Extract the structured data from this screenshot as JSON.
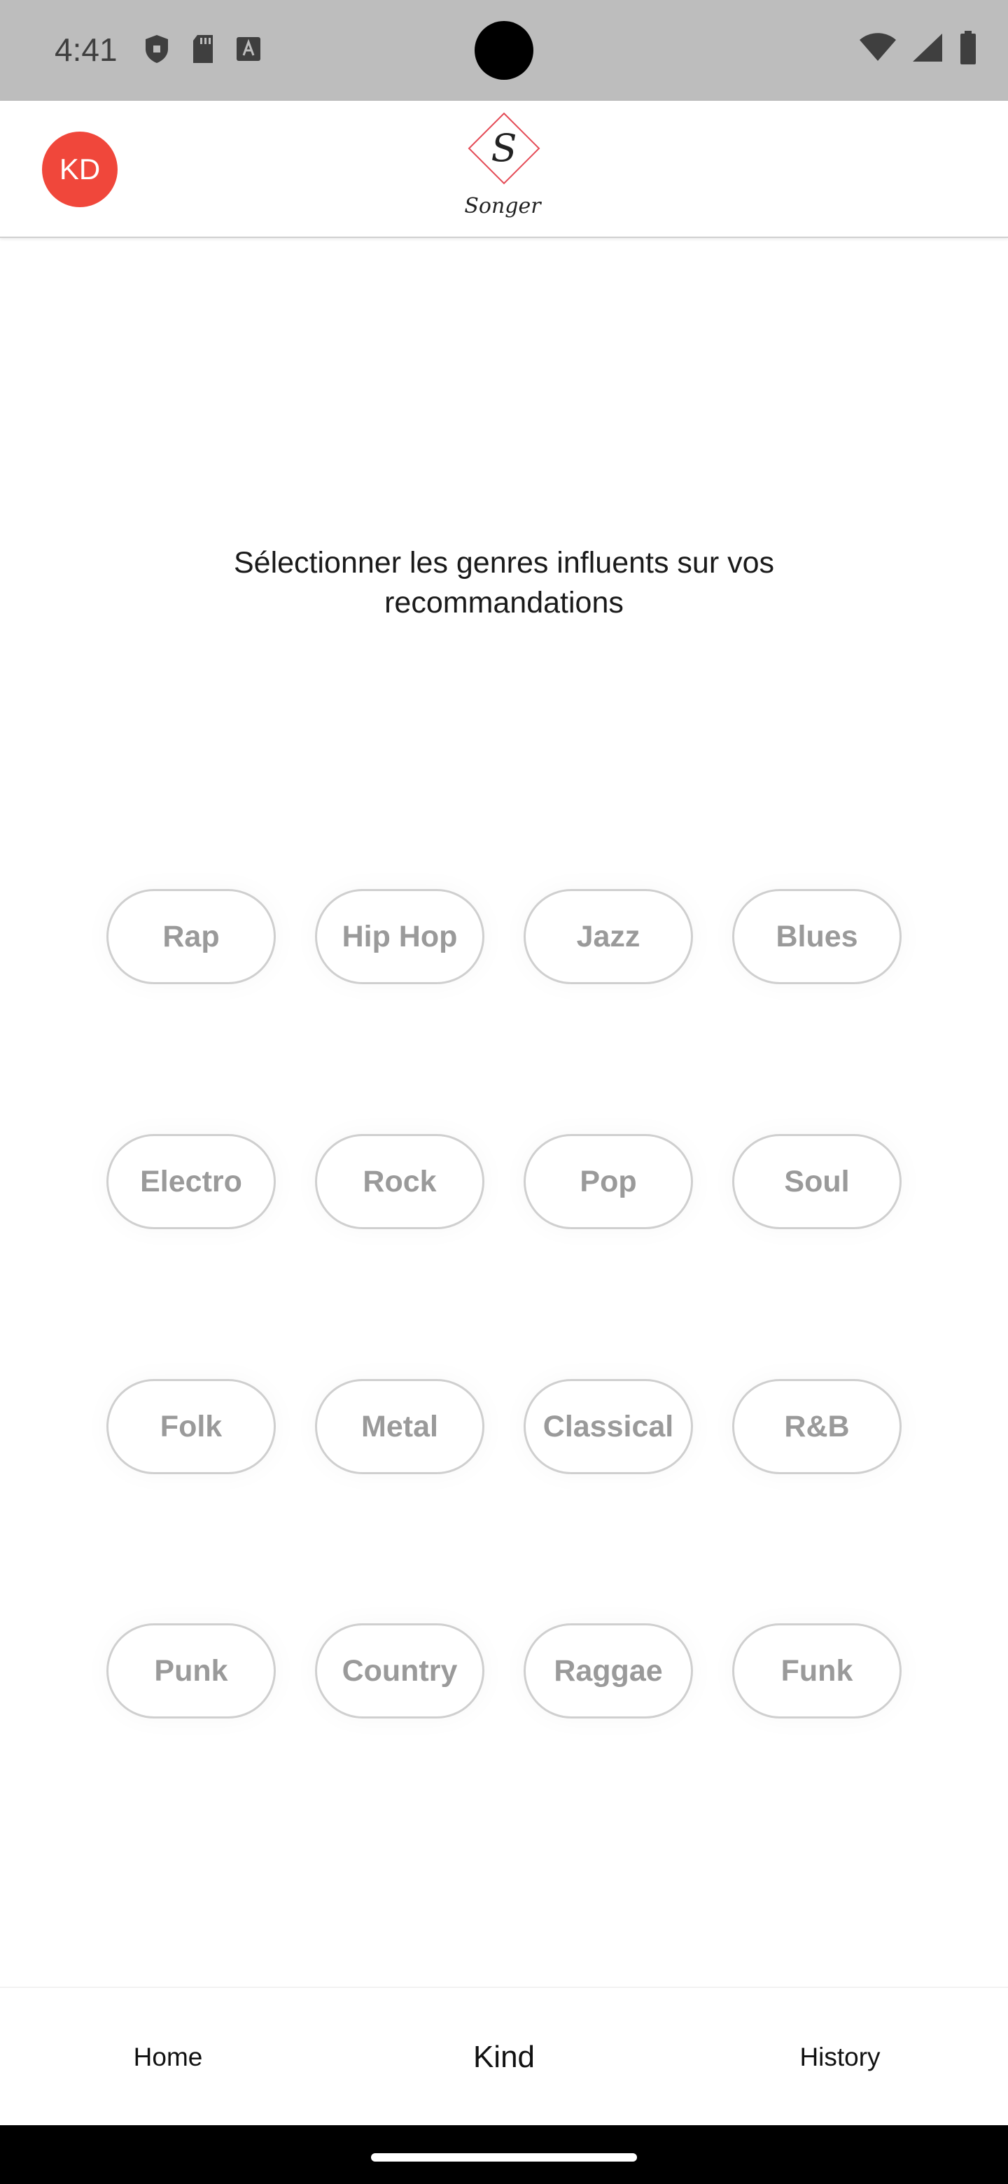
{
  "status_bar": {
    "time": "4:41",
    "left_icons": [
      "shield-icon",
      "sd-card-icon",
      "font-a-icon"
    ],
    "right_icons": [
      "wifi-icon",
      "signal-icon",
      "battery-icon"
    ],
    "color": "#bdbdbd"
  },
  "header": {
    "avatar_initials": "KD",
    "avatar_color": "#f0473b",
    "logo_letter": "S",
    "logo_wordmark": "Songer"
  },
  "prompt": {
    "text": "Sélectionner les genres influents sur vos recommandations"
  },
  "genres": [
    "Rap",
    "Hip Hop",
    "Jazz",
    "Blues",
    "Electro",
    "Rock",
    "Pop",
    "Soul",
    "Folk",
    "Metal",
    "Classical",
    "R&B",
    "Punk",
    "Country",
    "Raggae",
    "Funk"
  ],
  "nav": {
    "home": "Home",
    "kind": "Kind",
    "history": "History"
  }
}
